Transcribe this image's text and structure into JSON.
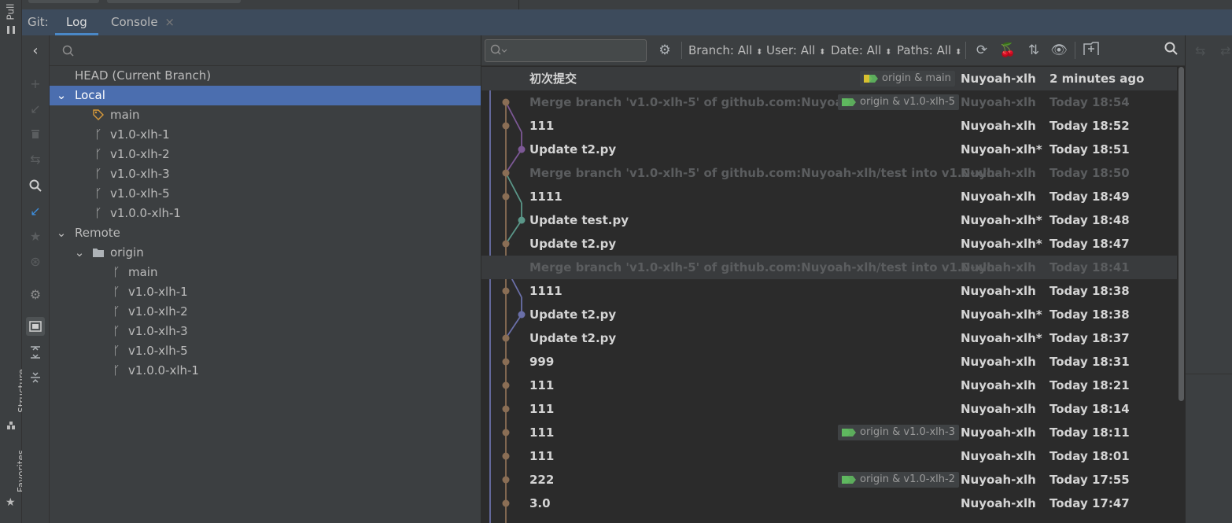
{
  "sidebar_labels": {
    "pull": "Pull",
    "structure": "Structure",
    "favorites": "Favorites"
  },
  "tabs": {
    "prefix": "Git:",
    "log": "Log",
    "console": "Console",
    "console_close": "×"
  },
  "branches": {
    "head": "HEAD (Current Branch)",
    "local": "Local",
    "local_items": [
      "main",
      "v1.0-xlh-1",
      "v1.0-xlh-2",
      "v1.0-xlh-3",
      "v1.0-xlh-5",
      "v1.0.0-xlh-1"
    ],
    "remote": "Remote",
    "origin": "origin",
    "remote_items": [
      "main",
      "v1.0-xlh-1",
      "v1.0-xlh-2",
      "v1.0-xlh-3",
      "v1.0-xlh-5",
      "v1.0.0-xlh-1"
    ]
  },
  "filters": {
    "branch": "Branch: All",
    "user": "User: All",
    "date": "Date: All",
    "paths": "Paths: All"
  },
  "commits": [
    {
      "message": "初次提交",
      "author": "Nuyoah-xlh",
      "date": "2 minutes ago",
      "ref": "origin & main"
    },
    {
      "message": "Merge branch 'v1.0-xlh-5' of github.com:Nuyoah-xl",
      "author": "Nuyoah-xlh",
      "date": "Today 18:54",
      "ref": "origin & v1.0-xlh-5"
    },
    {
      "message": "111",
      "author": "Nuyoah-xlh",
      "date": "Today 18:52"
    },
    {
      "message": "Update t2.py",
      "author": "Nuyoah-xlh*",
      "date": "Today 18:51"
    },
    {
      "message": "Merge branch 'v1.0-xlh-5' of github.com:Nuyoah-xlh/test into v1.0-xlh-",
      "author": "Nuyoah-xlh",
      "date": "Today 18:50"
    },
    {
      "message": "1111",
      "author": "Nuyoah-xlh",
      "date": "Today 18:49"
    },
    {
      "message": "Update test.py",
      "author": "Nuyoah-xlh*",
      "date": "Today 18:48"
    },
    {
      "message": "Update t2.py",
      "author": "Nuyoah-xlh*",
      "date": "Today 18:47"
    },
    {
      "message": "Merge branch 'v1.0-xlh-5' of github.com:Nuyoah-xlh/test into v1.0-xlh-",
      "author": "Nuyoah-xlh",
      "date": "Today 18:41"
    },
    {
      "message": "1111",
      "author": "Nuyoah-xlh",
      "date": "Today 18:38"
    },
    {
      "message": "Update t2.py",
      "author": "Nuyoah-xlh*",
      "date": "Today 18:38"
    },
    {
      "message": "Update t2.py",
      "author": "Nuyoah-xlh*",
      "date": "Today 18:37"
    },
    {
      "message": "999",
      "author": "Nuyoah-xlh",
      "date": "Today 18:31"
    },
    {
      "message": "111",
      "author": "Nuyoah-xlh",
      "date": "Today 18:21"
    },
    {
      "message": "111",
      "author": "Nuyoah-xlh",
      "date": "Today 18:14"
    },
    {
      "message": "111",
      "author": "Nuyoah-xlh",
      "date": "Today 18:11",
      "ref": "origin & v1.0-xlh-3"
    },
    {
      "message": "111",
      "author": "Nuyoah-xlh",
      "date": "Today 18:01"
    },
    {
      "message": "222",
      "author": "Nuyoah-xlh",
      "date": "Today 17:55",
      "ref": "origin & v1.0-xlh-2"
    },
    {
      "message": "3.0",
      "author": "Nuyoah-xlh",
      "date": "Today 17:47"
    }
  ],
  "colors": {
    "selection": "#4b6eaf",
    "accent_tab": "#4a88c7",
    "graph_main": "#8a6e55",
    "graph_purple": "#7c5895",
    "graph_teal": "#5a9688",
    "graph_blue": "#6a6fa8",
    "tag_green": "#5fb85f",
    "tag_yellow": "#d8c030"
  }
}
